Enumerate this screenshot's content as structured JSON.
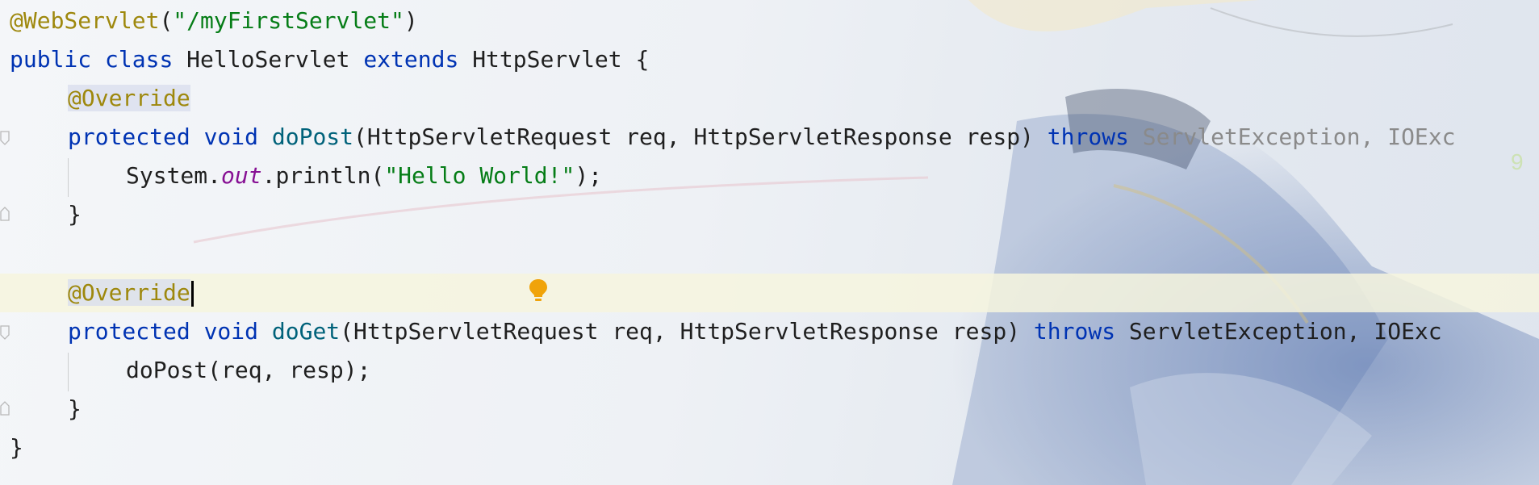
{
  "code": {
    "l1": {
      "annotation": "@WebServlet",
      "open": "(",
      "path": "\"/myFirstServlet\"",
      "close": ")"
    },
    "l2": {
      "kw1": "public",
      "kw2": "class",
      "name": "HelloServlet",
      "kw3": "extends",
      "parent": "HttpServlet",
      "brace": "{"
    },
    "l3": {
      "annotation": "@Override"
    },
    "l4": {
      "kw1": "protected",
      "kw2": "void",
      "method": "doPost",
      "params": "(HttpServletRequest req, HttpServletResponse resp)",
      "throws": "throws",
      "exceptions": "ServletException, IOExc"
    },
    "l5": {
      "obj": "System.",
      "field": "out",
      "call": ".println(",
      "str": "\"Hello World!\"",
      "end": ");"
    },
    "l6": {
      "brace": "}"
    },
    "l7": {
      "annotation": "@Override"
    },
    "l8": {
      "kw1": "protected",
      "kw2": "void",
      "method": "doGet",
      "params": "(HttpServletRequest req, HttpServletResponse resp)",
      "throws": "throws",
      "exceptions": "ServletException, IOExc"
    },
    "l9": {
      "stmt": "doPost(req, resp);"
    },
    "l10": {
      "brace": "}"
    },
    "l11": {
      "brace": "}"
    }
  },
  "icons": {
    "intention_bulb": "lightbulb-icon",
    "fold_markers": "fold-marker-icon"
  },
  "colors": {
    "keyword": "#0033b3",
    "annotation": "#9e880d",
    "string": "#067d17",
    "method": "#00627a",
    "static_field": "#871094",
    "current_line": "#f6f4de",
    "bulb": "#f0a30a"
  }
}
